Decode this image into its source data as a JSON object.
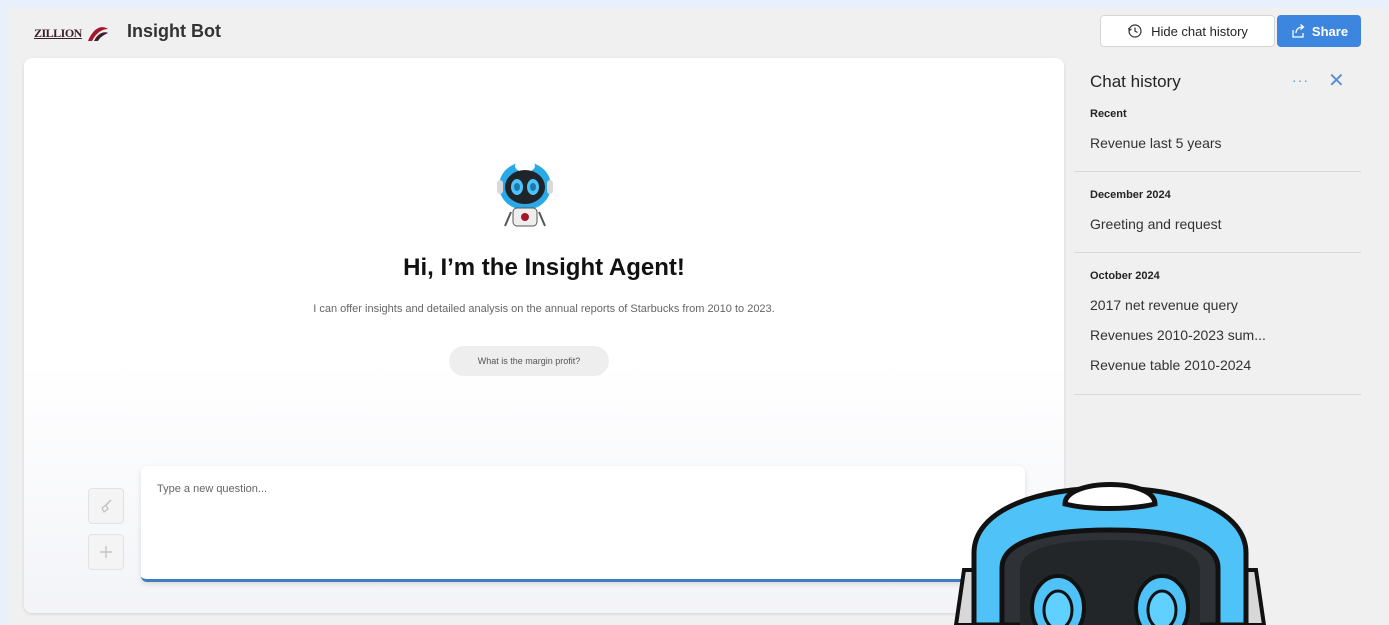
{
  "header": {
    "logo_text": "ZILLION",
    "title": "Insight Bot",
    "hide_history_label": "Hide chat history",
    "share_label": "Share"
  },
  "welcome": {
    "title": "Hi, I’m the Insight Agent!",
    "subtitle": "I can offer insights and detailed analysis on the annual reports of Starbucks from 2010 to 2023.",
    "suggestion": "What is the margin profit?"
  },
  "input": {
    "placeholder": "Type a new question..."
  },
  "history": {
    "title": "Chat history",
    "more": "···",
    "close": "✕",
    "groups": [
      {
        "label": "Recent",
        "items": [
          "Revenue last 5 years"
        ]
      },
      {
        "label": "December 2024",
        "items": [
          "Greeting and request"
        ]
      },
      {
        "label": "October 2024",
        "items": [
          "2017 net revenue query",
          "Revenues 2010-2023 sum...",
          "Revenue table 2010-2024"
        ]
      }
    ]
  },
  "icons": {
    "history": "history-clock-icon",
    "share": "share-icon",
    "clear": "broom-icon",
    "new_chat": "plus-icon"
  },
  "colors": {
    "accent": "#3d86e0",
    "background": "#e8f1fb",
    "robot_blue": "#4fc3f7"
  }
}
